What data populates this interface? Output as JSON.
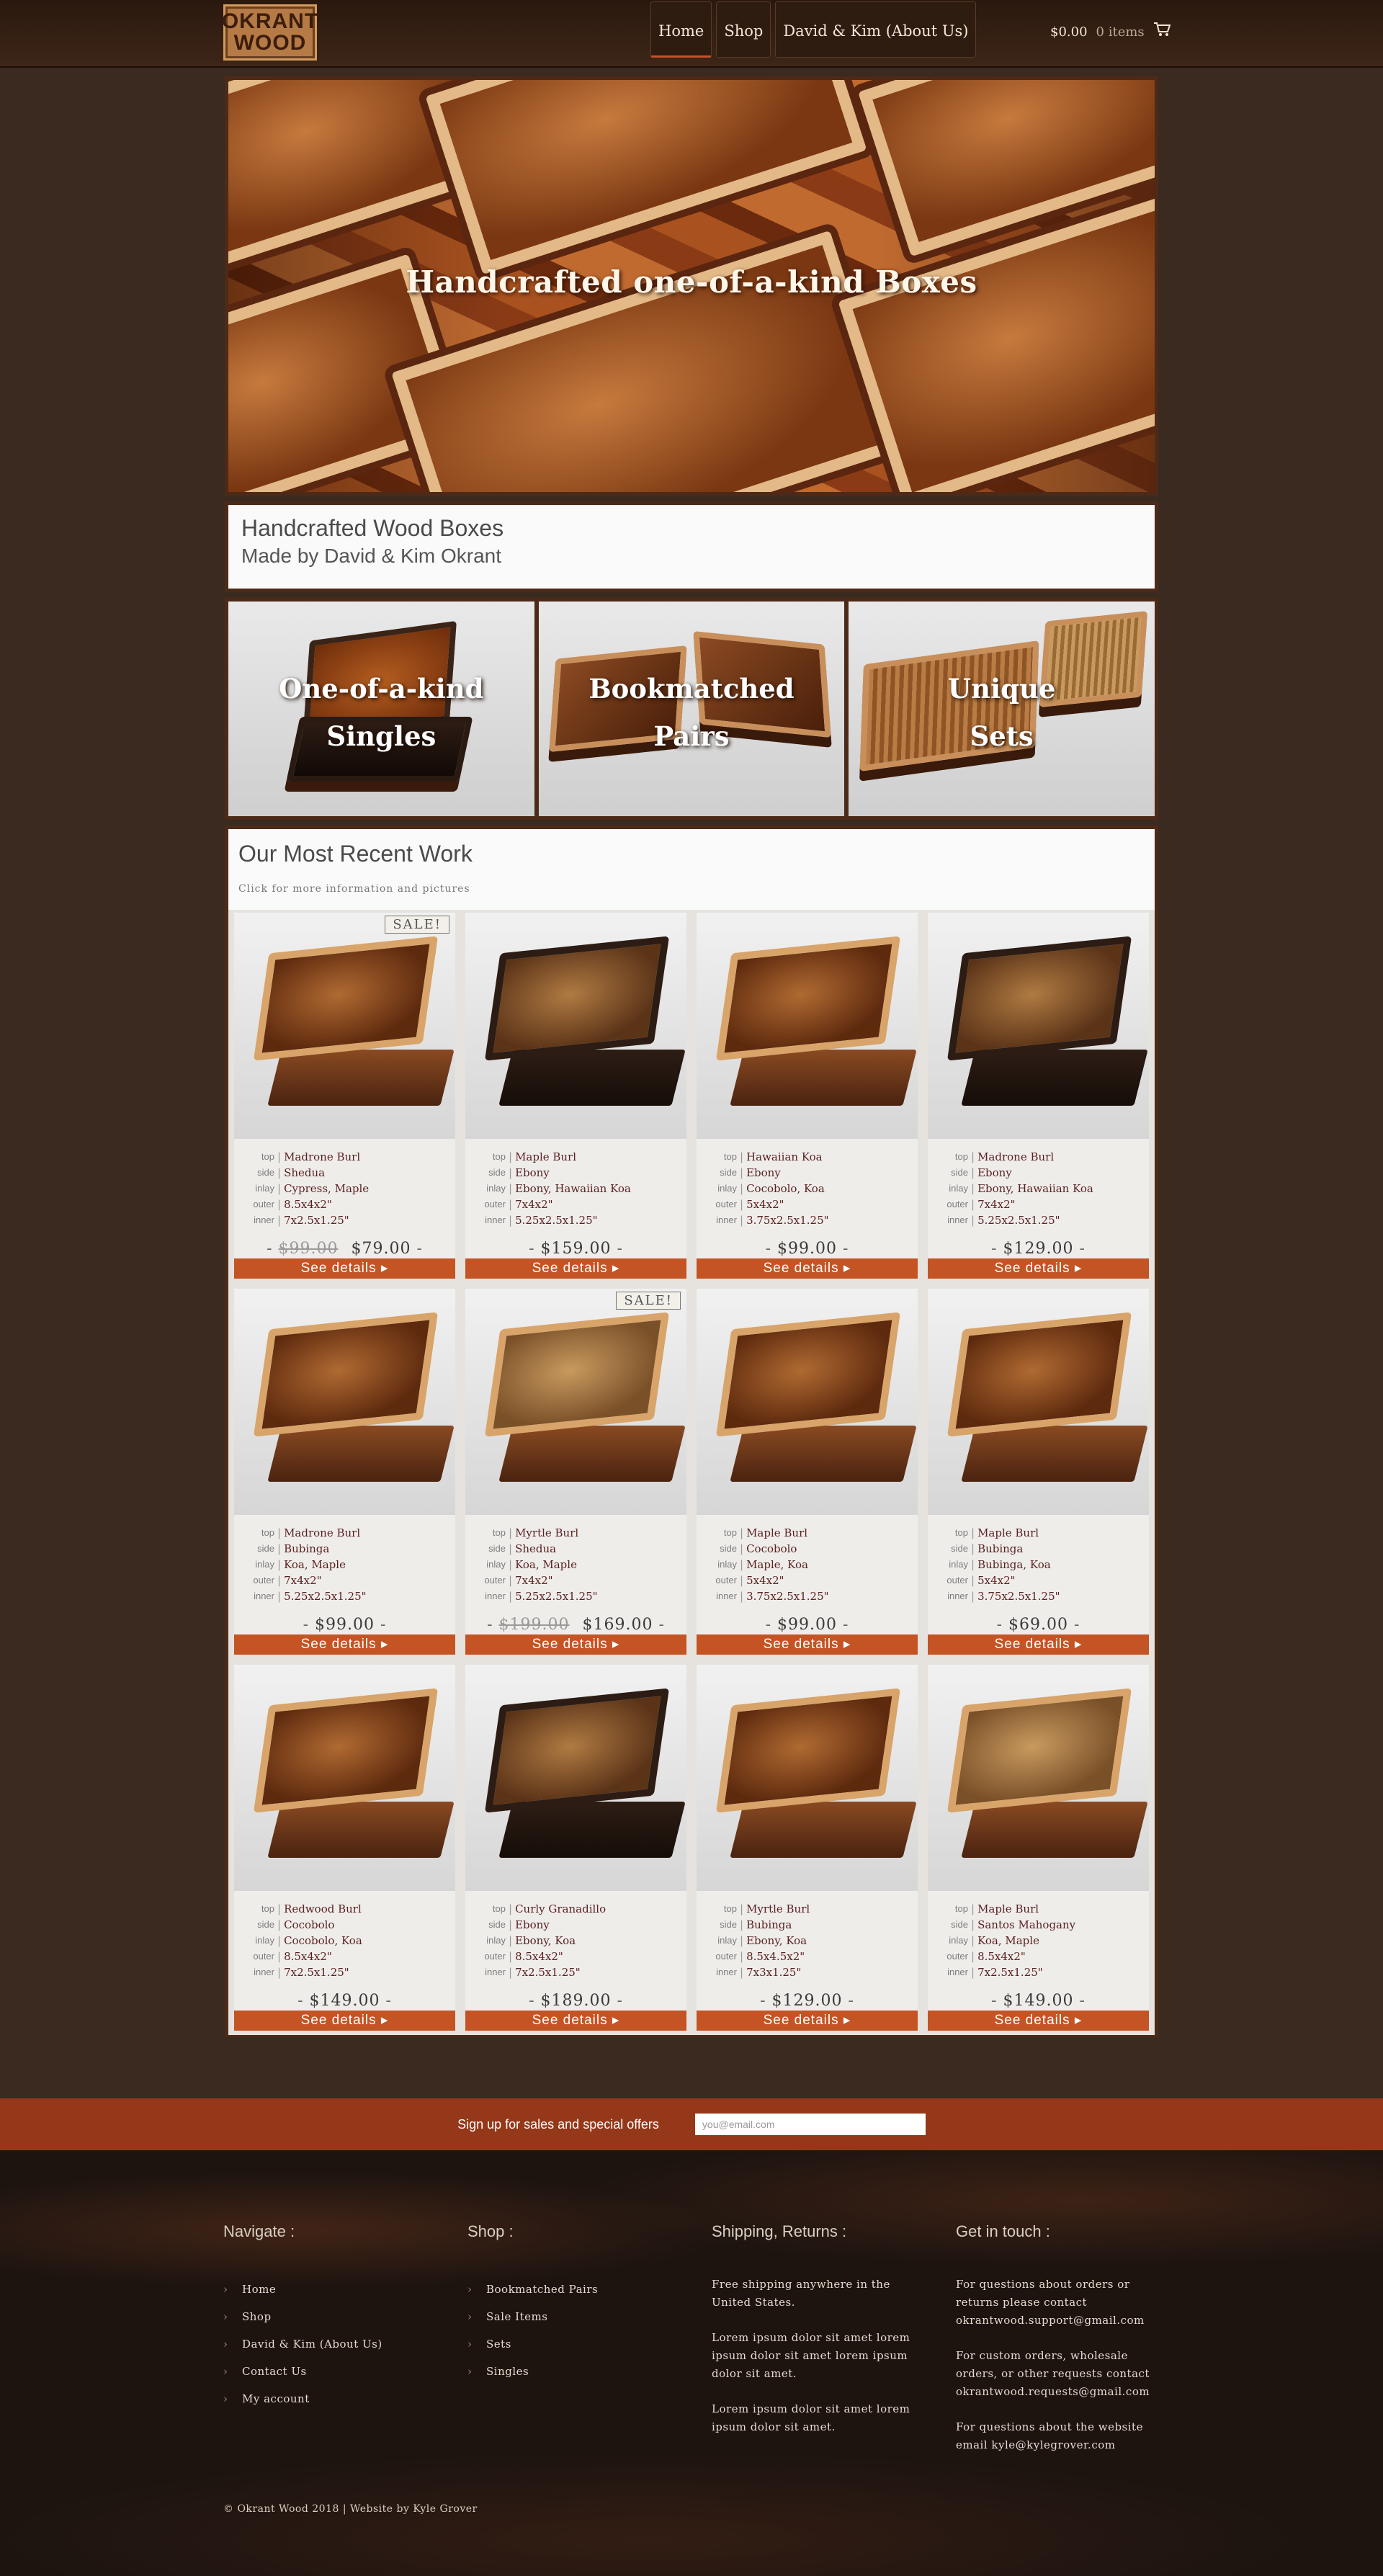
{
  "header": {
    "logo_line1": "OKRANT",
    "logo_line2": "WOOD",
    "nav": [
      "Home",
      "Shop",
      "David & Kim (About Us)"
    ],
    "cart_total": "$0.00",
    "cart_items": "0 items"
  },
  "hero": {
    "title": "Handcrafted one-of-a-kind Boxes"
  },
  "intro": {
    "title": "Handcrafted Wood Boxes",
    "subtitle": "Made by David & Kim Okrant"
  },
  "categories": [
    {
      "line1": "One-of-a-kind",
      "line2": "Singles"
    },
    {
      "line1": "Bookmatched",
      "line2": "Pairs"
    },
    {
      "line1": "Unique",
      "line2": "Sets"
    }
  ],
  "recent": {
    "title": "Our Most Recent Work",
    "subtitle": "Click for more information and pictures",
    "spec_labels": {
      "top": "top",
      "side": "side",
      "inlay": "inlay",
      "outer": "outer",
      "inner": "inner"
    },
    "button_label": "See details ▸",
    "sale_label": "SALE!",
    "products": [
      {
        "top": "Madrone Burl",
        "side": "Shedua",
        "inlay": "Cypress, Maple",
        "outer": "8.5x4x2\"",
        "inner": "7x2.5x1.25\"",
        "old_price": "$99.00",
        "price": "$79.00",
        "sale": true
      },
      {
        "top": "Maple Burl",
        "side": "Ebony",
        "inlay": "Ebony, Hawaiian Koa",
        "outer": "7x4x2\"",
        "inner": "5.25x2.5x1.25\"",
        "old_price": "",
        "price": "$159.00",
        "sale": false
      },
      {
        "top": "Hawaiian Koa",
        "side": "Ebony",
        "inlay": "Cocobolo, Koa",
        "outer": "5x4x2\"",
        "inner": "3.75x2.5x1.25\"",
        "old_price": "",
        "price": "$99.00",
        "sale": false
      },
      {
        "top": "Madrone Burl",
        "side": "Ebony",
        "inlay": "Ebony, Hawaiian Koa",
        "outer": "7x4x2\"",
        "inner": "5.25x2.5x1.25\"",
        "old_price": "",
        "price": "$129.00",
        "sale": false
      },
      {
        "top": "Madrone Burl",
        "side": "Bubinga",
        "inlay": "Koa, Maple",
        "outer": "7x4x2\"",
        "inner": "5.25x2.5x1.25\"",
        "old_price": "",
        "price": "$99.00",
        "sale": false
      },
      {
        "top": "Myrtle Burl",
        "side": "Shedua",
        "inlay": "Koa, Maple",
        "outer": "7x4x2\"",
        "inner": "5.25x2.5x1.25\"",
        "old_price": "$199.00",
        "price": "$169.00",
        "sale": true
      },
      {
        "top": "Maple Burl",
        "side": "Cocobolo",
        "inlay": "Maple, Koa",
        "outer": "5x4x2\"",
        "inner": "3.75x2.5x1.25\"",
        "old_price": "",
        "price": "$99.00",
        "sale": false
      },
      {
        "top": "Maple Burl",
        "side": "Bubinga",
        "inlay": "Bubinga, Koa",
        "outer": "5x4x2\"",
        "inner": "3.75x2.5x1.25\"",
        "old_price": "",
        "price": "$69.00",
        "sale": false
      },
      {
        "top": "Redwood Burl",
        "side": "Cocobolo",
        "inlay": "Cocobolo, Koa",
        "outer": "8.5x4x2\"",
        "inner": "7x2.5x1.25\"",
        "old_price": "",
        "price": "$149.00",
        "sale": false
      },
      {
        "top": "Curly Granadillo",
        "side": "Ebony",
        "inlay": "Ebony, Koa",
        "outer": "8.5x4x2\"",
        "inner": "7x2.5x1.25\"",
        "old_price": "",
        "price": "$189.00",
        "sale": false
      },
      {
        "top": "Myrtle Burl",
        "side": "Bubinga",
        "inlay": "Ebony, Koa",
        "outer": "8.5x4.5x2\"",
        "inner": "7x3x1.25\"",
        "old_price": "",
        "price": "$129.00",
        "sale": false
      },
      {
        "top": "Maple Burl",
        "side": "Santos Mahogany",
        "inlay": "Koa, Maple",
        "outer": "8.5x4x2\"",
        "inner": "7x2.5x1.25\"",
        "old_price": "",
        "price": "$149.00",
        "sale": false
      }
    ]
  },
  "signup": {
    "label": "Sign up for sales and special offers",
    "placeholder": "you@email.com"
  },
  "footer": {
    "navigate": {
      "title": "Navigate :",
      "links": [
        "Home",
        "Shop",
        "David & Kim (About Us)",
        "Contact Us",
        "My account"
      ]
    },
    "shop": {
      "title": "Shop :",
      "links": [
        "Bookmatched Pairs",
        "Sale Items",
        "Sets",
        "Singles"
      ]
    },
    "shipping": {
      "title": "Shipping, Returns :",
      "paragraphs": [
        "Free shipping anywhere in the United States.",
        "Lorem ipsum dolor sit amet lorem ipsum dolor sit amet lorem ipsum dolor sit amet.",
        "Lorem ipsum dolor sit amet lorem ipsum dolor sit amet."
      ]
    },
    "contact": {
      "title": "Get in touch :",
      "paragraphs": [
        "For questions about orders or returns please contact okrantwood.support@gmail.com",
        "For custom orders, wholesale orders, or other requests contact okrantwood.requests@gmail.com",
        "For questions about the website email kyle@kylegrover.com"
      ]
    },
    "copyright": "© Okrant Wood 2018 | Website by Kyle Grover"
  }
}
